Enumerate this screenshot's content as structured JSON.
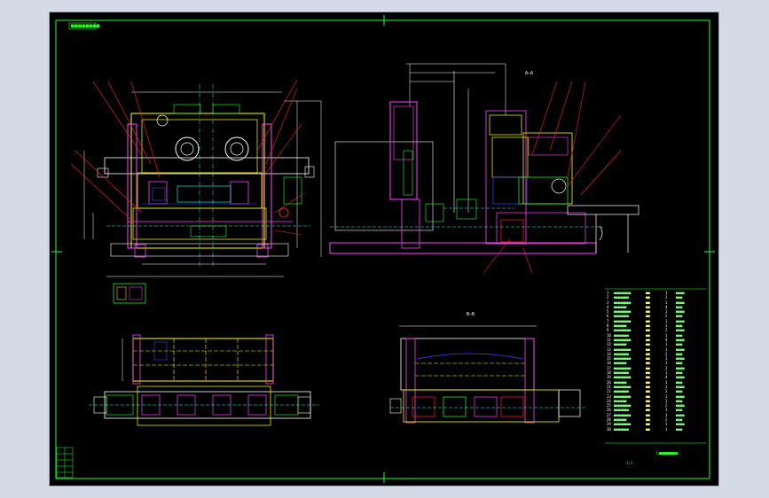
{
  "drawing": {
    "title_tag": "■■■■■■■■",
    "tech_note": "L■■■■■■■",
    "scale_note": "1:2",
    "section_label_top": "A—A",
    "section_label_bottom": "B—B"
  },
  "part_list": [
    {
      "no": "1",
      "name": "■■■■■■■■",
      "code": "■■",
      "qty": "1",
      "mat": "■■■■"
    },
    {
      "no": "2",
      "name": "■■■■■■■",
      "code": "■■",
      "qty": "2",
      "mat": "■■■"
    },
    {
      "no": "3",
      "name": "■■■■■■■■",
      "code": "■■",
      "qty": "1",
      "mat": "■■■■"
    },
    {
      "no": "4",
      "name": "■■■■■■",
      "code": "■■",
      "qty": "4",
      "mat": "■■■"
    },
    {
      "no": "5",
      "name": "■■■■■■■■",
      "code": "■■",
      "qty": "1",
      "mat": "■■■■"
    },
    {
      "no": "6",
      "name": "■■■■■■■",
      "code": "■■",
      "qty": "2",
      "mat": "■■■"
    },
    {
      "no": "7",
      "name": "■■■■■■■■",
      "code": "■■",
      "qty": "1",
      "mat": "■■■■"
    },
    {
      "no": "8",
      "name": "■■■■■■",
      "code": "■■",
      "qty": "1",
      "mat": "■■■"
    },
    {
      "no": "9",
      "name": "■■■■■■■■",
      "code": "■■",
      "qty": "2",
      "mat": "■■■■"
    },
    {
      "no": "10",
      "name": "■■■■■■■",
      "code": "■■",
      "qty": "1",
      "mat": "■■■"
    },
    {
      "no": "11",
      "name": "■■■■■■■■",
      "code": "■■",
      "qty": "4",
      "mat": "■■■■"
    },
    {
      "no": "12",
      "name": "■■■■■■",
      "code": "■■",
      "qty": "1",
      "mat": "■■■"
    },
    {
      "no": "13",
      "name": "■■■■■■■■",
      "code": "■■",
      "qty": "1",
      "mat": "■■■■"
    },
    {
      "no": "14",
      "name": "■■■■■■■",
      "code": "■■",
      "qty": "2",
      "mat": "■■■"
    },
    {
      "no": "15",
      "name": "■■■■■■■■",
      "code": "■■",
      "qty": "1",
      "mat": "■■■■"
    },
    {
      "no": "16",
      "name": "■■■■■■",
      "code": "■■",
      "qty": "1",
      "mat": "■■■"
    },
    {
      "no": "17",
      "name": "■■■■■■■■",
      "code": "■■",
      "qty": "2",
      "mat": "■■■■"
    },
    {
      "no": "18",
      "name": "■■■■■■■",
      "code": "■■",
      "qty": "1",
      "mat": "■■■"
    },
    {
      "no": "19",
      "name": "■■■■■■■■",
      "code": "■■",
      "qty": "4",
      "mat": "■■■■"
    },
    {
      "no": "20",
      "name": "■■■■■■",
      "code": "■■",
      "qty": "1",
      "mat": "■■■"
    },
    {
      "no": "21",
      "name": "■■■■■■■■",
      "code": "■■",
      "qty": "1",
      "mat": "■■■■"
    },
    {
      "no": "22",
      "name": "■■■■■■■",
      "code": "■■",
      "qty": "2",
      "mat": "■■■"
    },
    {
      "no": "23",
      "name": "■■■■■■■■",
      "code": "■■",
      "qty": "1",
      "mat": "■■■■"
    },
    {
      "no": "24",
      "name": "■■■■■■",
      "code": "■■",
      "qty": "1",
      "mat": "■■■"
    },
    {
      "no": "25",
      "name": "■■■■■■■■",
      "code": "■■",
      "qty": "2",
      "mat": "■■■■"
    },
    {
      "no": "26",
      "name": "■■■■■■■",
      "code": "■■",
      "qty": "1",
      "mat": "■■■"
    },
    {
      "no": "27",
      "name": "■■■■■■■■",
      "code": "■■",
      "qty": "1",
      "mat": "■■■■"
    },
    {
      "no": "28",
      "name": "■■■■■■",
      "code": "■■",
      "qty": "2",
      "mat": "■■■"
    },
    {
      "no": "29",
      "name": "■■■■■■■■",
      "code": "■■",
      "qty": "1",
      "mat": "■■■■"
    },
    {
      "no": "30",
      "name": "■■■■■■■",
      "code": "■■",
      "qty": "1",
      "mat": "■■■"
    }
  ],
  "colors": {
    "frame": "#2aff2a",
    "yellow": "#ffff00",
    "red": "#ff2020",
    "magenta": "#ff40ff",
    "cyan": "#30ffff",
    "white": "#ffffff",
    "blue": "#3050ff"
  }
}
